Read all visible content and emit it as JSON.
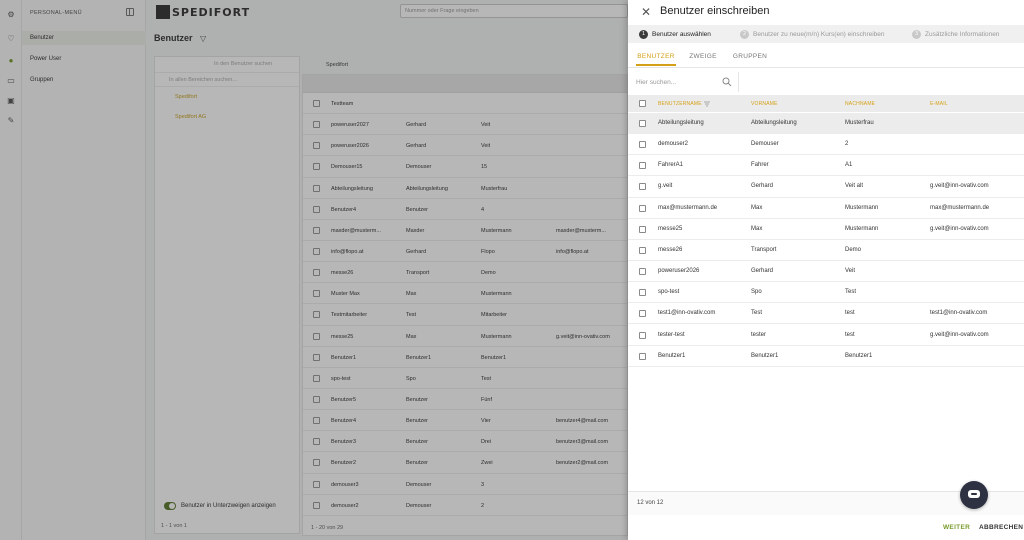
{
  "background": {
    "personal_menu": {
      "title": "PERSONAL-MENÜ",
      "items": [
        {
          "label": "Benutzer",
          "active": true
        },
        {
          "label": "Power User",
          "active": false
        },
        {
          "label": "Gruppen",
          "active": false
        }
      ]
    },
    "logo_text": "SPEDIFORT",
    "top_search_placeholder": "Nummer oder Frage eingeben",
    "page_title": "Benutzer",
    "tree": {
      "search_placeholder": "In allen Bereichen suchen...",
      "nodes": [
        "Spedifort",
        "Spedifort AG"
      ],
      "footer": "1 - 1 von 1"
    },
    "main_search_placeholder": "In den Benutzer suchen",
    "company_dropdown": "Spedifort",
    "show_sub_toggle_label": "Benutzer in Unterzweigen anzeigen",
    "table": {
      "rows": [
        [
          "Testteam",
          "",
          "",
          ""
        ],
        [
          "poweruser2027",
          "Gerhard",
          "Veit",
          ""
        ],
        [
          "poweruser2026",
          "Gerhard",
          "Veit",
          ""
        ],
        [
          "Demouser15",
          "Demouser",
          "15",
          ""
        ],
        [
          "Abteilungsleitung",
          "Abteilungsleitung",
          "Musterfrau",
          ""
        ],
        [
          "Benutzer4",
          "Benutzer",
          "4",
          ""
        ],
        [
          "maxder@musterm...",
          "Maxder",
          "Mustermann",
          "maxder@musterm..."
        ],
        [
          "info@flopo.at",
          "Gerhard",
          "Flopo",
          "info@flopo.at"
        ],
        [
          "messe26",
          "Transport",
          "Demo",
          ""
        ],
        [
          "Muster Max",
          "Max",
          "Mustermann",
          ""
        ],
        [
          "Testmitarbeiter",
          "Test",
          "Mitarbeiter",
          ""
        ],
        [
          "messe25",
          "Max",
          "Mustermann",
          "g.veit@inn-ovativ.com"
        ],
        [
          "Benutzer1",
          "Benutzer1",
          "Benutzer1",
          ""
        ],
        [
          "spo-test",
          "Spo",
          "Test",
          ""
        ],
        [
          "Benutzer5",
          "Benutzer",
          "Fünf",
          ""
        ],
        [
          "Benutzer4",
          "Benutzer",
          "Vier",
          "benutzer4@mail.com"
        ],
        [
          "Benutzer3",
          "Benutzer",
          "Drei",
          "benutzer3@mail.com"
        ],
        [
          "Benutzer2",
          "Benutzer",
          "Zwei",
          "benutzer2@mail.com"
        ],
        [
          "demouser3",
          "Demouser",
          "3",
          ""
        ],
        [
          "demouser2",
          "Demouser",
          "2",
          ""
        ]
      ],
      "footer": "1 - 20 von 29"
    }
  },
  "drawer": {
    "title": "Benutzer einschreiben",
    "steps": [
      {
        "num": "1",
        "label": "Benutzer auswählen",
        "active": true
      },
      {
        "num": "2",
        "label": "Benutzer zu neue(m/n) Kurs(en) einschreiben",
        "active": false
      },
      {
        "num": "3",
        "label": "Zusätzliche Informationen",
        "active": false
      }
    ],
    "tabs": [
      {
        "label": "BENUTZER",
        "active": true
      },
      {
        "label": "ZWEIGE",
        "active": false
      },
      {
        "label": "GRUPPEN",
        "active": false
      }
    ],
    "search_placeholder": "Hier suchen...",
    "columns": [
      "BENUTZERNAME",
      "VORNAME",
      "NACHNAME",
      "E-MAIL"
    ],
    "rows": [
      {
        "username": "Abteilungsleitung",
        "firstname": "Abteilungsleitung",
        "lastname": "Musterfrau",
        "email": ""
      },
      {
        "username": "demouser2",
        "firstname": "Demouser",
        "lastname": "2",
        "email": ""
      },
      {
        "username": "FahrerA1",
        "firstname": "Fahrer",
        "lastname": "A1",
        "email": ""
      },
      {
        "username": "g.veit",
        "firstname": "Gerhard",
        "lastname": "Veit alt",
        "email": "g.veit@inn-ovativ.com"
      },
      {
        "username": "max@mustermann.de",
        "firstname": "Max",
        "lastname": "Mustermann",
        "email": "max@mustermann.de"
      },
      {
        "username": "messe25",
        "firstname": "Max",
        "lastname": "Mustermann",
        "email": "g.veit@inn-ovativ.com"
      },
      {
        "username": "messe26",
        "firstname": "Transport",
        "lastname": "Demo",
        "email": ""
      },
      {
        "username": "poweruser2026",
        "firstname": "Gerhard",
        "lastname": "Veit",
        "email": ""
      },
      {
        "username": "spo-test",
        "firstname": "Spo",
        "lastname": "Test",
        "email": ""
      },
      {
        "username": "test1@inn-ovativ.com",
        "firstname": "Test",
        "lastname": "test",
        "email": "test1@inn-ovativ.com"
      },
      {
        "username": "tester-test",
        "firstname": "tester",
        "lastname": "test",
        "email": "g.veit@inn-ovativ.com"
      },
      {
        "username": "Benutzer1",
        "firstname": "Benutzer1",
        "lastname": "Benutzer1",
        "email": ""
      }
    ],
    "count_label": "12 von 12",
    "next_label": "WEITER",
    "cancel_label": "ABBRECHEN"
  },
  "colors": {
    "accent": "#d4a017",
    "next_button": "#7a9c2e",
    "chat_button": "#2d3142"
  }
}
